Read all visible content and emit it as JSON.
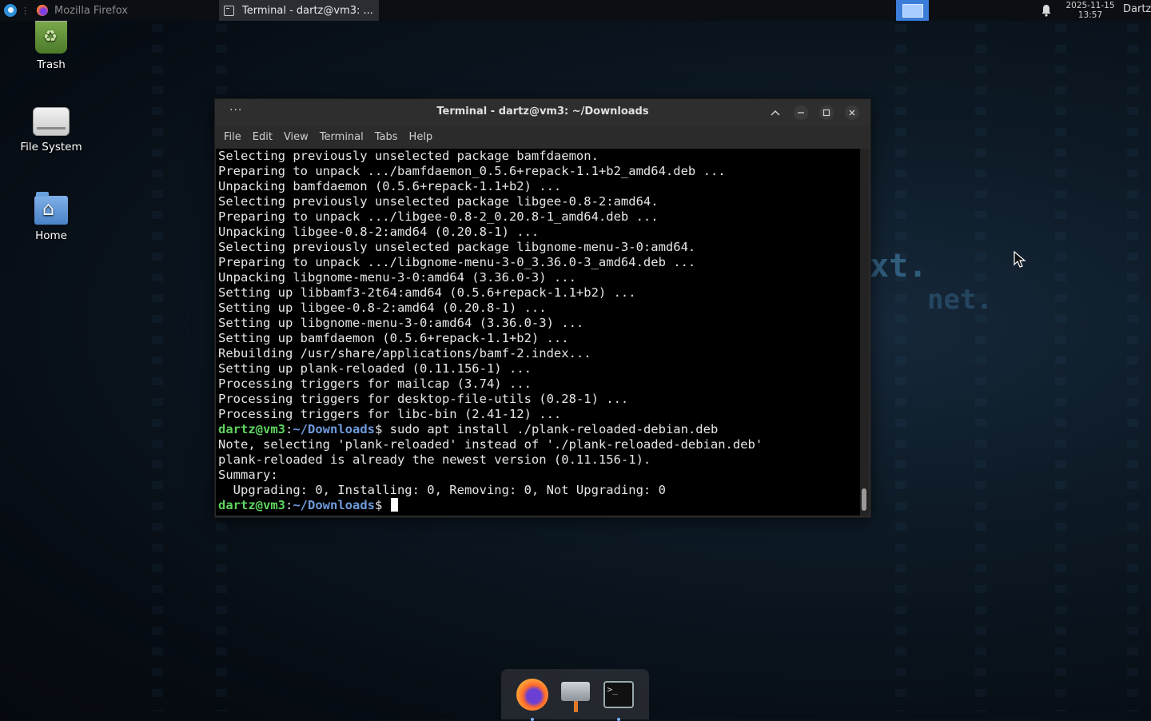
{
  "panel": {
    "firefox_task": "Mozilla Firefox",
    "terminal_task": "Terminal - dartz@vm3: ...",
    "clock_date": "2025-11-15",
    "clock_time": "13:57",
    "user": "Dartz"
  },
  "desktop": {
    "icons": [
      {
        "label": "Trash",
        "icon": "trash-icon"
      },
      {
        "label": "File System",
        "icon": "drive-icon"
      },
      {
        "label": "Home",
        "icon": "home-folder-icon"
      }
    ]
  },
  "terminal": {
    "title": "Terminal - dartz@vm3: ~/Downloads",
    "menu": [
      "File",
      "Edit",
      "View",
      "Terminal",
      "Tabs",
      "Help"
    ],
    "lines": [
      "Selecting previously unselected package bamfdaemon.",
      "Preparing to unpack .../bamfdaemon_0.5.6+repack-1.1+b2_amd64.deb ...",
      "Unpacking bamfdaemon (0.5.6+repack-1.1+b2) ...",
      "Selecting previously unselected package libgee-0.8-2:amd64.",
      "Preparing to unpack .../libgee-0.8-2_0.20.8-1_amd64.deb ...",
      "Unpacking libgee-0.8-2:amd64 (0.20.8-1) ...",
      "Selecting previously unselected package libgnome-menu-3-0:amd64.",
      "Preparing to unpack .../libgnome-menu-3-0_3.36.0-3_amd64.deb ...",
      "Unpacking libgnome-menu-3-0:amd64 (3.36.0-3) ...",
      "Setting up libbamf3-2t64:amd64 (0.5.6+repack-1.1+b2) ...",
      "Setting up libgee-0.8-2:amd64 (0.20.8-1) ...",
      "Setting up libgnome-menu-3-0:amd64 (3.36.0-3) ...",
      "Setting up bamfdaemon (0.5.6+repack-1.1+b2) ...",
      "Rebuilding /usr/share/applications/bamf-2.index...",
      "Setting up plank-reloaded (0.11.156-1) ...",
      "Processing triggers for mailcap (3.74) ...",
      "Processing triggers for desktop-file-utils (0.28-1) ...",
      "Processing triggers for libc-bin (2.41-12) ..."
    ],
    "prompt_user": "dartz@vm3",
    "prompt_sep": ":",
    "prompt_path": "~/Downloads",
    "prompt_sigil": "$",
    "command": " sudo apt install ./plank-reloaded-debian.deb",
    "output": [
      "Note, selecting 'plank-reloaded' instead of './plank-reloaded-debian.deb'",
      "plank-reloaded is already the newest version (0.11.156-1).",
      "Summary:",
      "  Upgrading: 0, Installing: 0, Removing: 0, Not Upgrading: 0"
    ]
  },
  "wallpaper_text": [
    "xt.",
    "net."
  ],
  "dock": {
    "items": [
      {
        "name": "firefox",
        "icon": "firefox-icon",
        "running": true
      },
      {
        "name": "plank",
        "icon": "plank-icon",
        "running": false
      },
      {
        "name": "terminal",
        "icon": "terminal-icon",
        "running": true
      }
    ]
  },
  "colors": {
    "prompt_user": "#5fd35f",
    "prompt_path": "#6f9bdc",
    "workspace_active": "#3b7dd8"
  }
}
